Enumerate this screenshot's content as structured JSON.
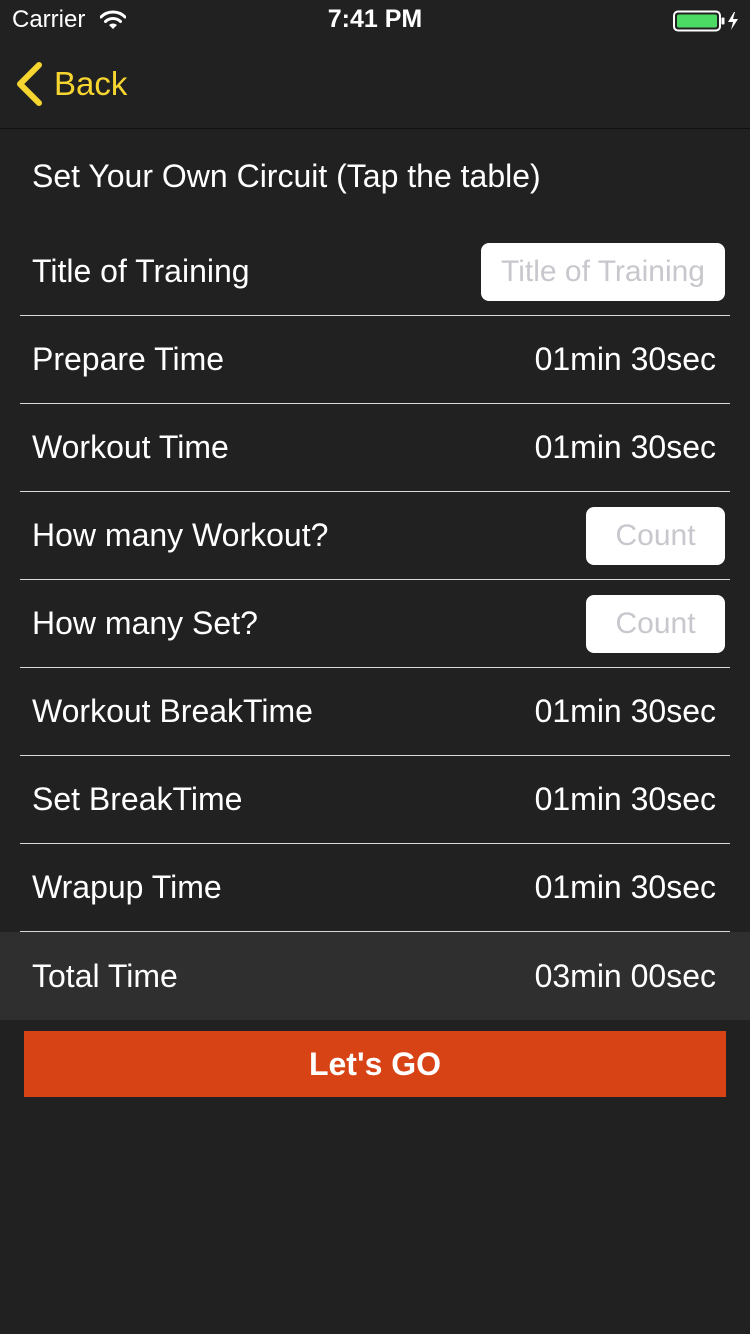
{
  "status_bar": {
    "carrier": "Carrier",
    "time": "7:41 PM",
    "wifi_icon": "wifi-icon",
    "battery_icon": "battery-charging-icon",
    "battery_level": 1.0,
    "battery_color": "#4cd964"
  },
  "nav": {
    "back_label": "Back",
    "back_icon": "chevron-left-icon",
    "accent_color": "#f7d531"
  },
  "section": {
    "header": "Set Your Own Circuit (Tap the table)"
  },
  "rows": [
    {
      "label": "Title of Training",
      "type": "input",
      "value": "",
      "placeholder": "Title of Training"
    },
    {
      "label": "Prepare Time",
      "type": "value",
      "value": "01min 30sec"
    },
    {
      "label": "Workout Time",
      "type": "value",
      "value": "01min 30sec"
    },
    {
      "label": "How many Workout?",
      "type": "input",
      "value": "",
      "placeholder": "Count"
    },
    {
      "label": "How many Set?",
      "type": "input",
      "value": "",
      "placeholder": "Count"
    },
    {
      "label": "Workout BreakTime",
      "type": "value",
      "value": "01min 30sec"
    },
    {
      "label": "Set BreakTime",
      "type": "value",
      "value": "01min 30sec"
    },
    {
      "label": "Wrapup Time",
      "type": "value",
      "value": "01min 30sec"
    }
  ],
  "total": {
    "label": "Total Time",
    "value": "03min 00sec"
  },
  "go_button": {
    "label": "Let's GO",
    "color": "#d84315"
  }
}
